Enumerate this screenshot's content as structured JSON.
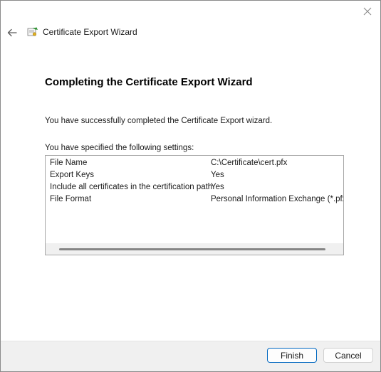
{
  "window": {
    "title": "Certificate Export Wizard",
    "icons": {
      "close": "close-icon",
      "back": "back-arrow-icon",
      "wizard": "certificate-wizard-icon"
    }
  },
  "page": {
    "heading": "Completing the Certificate Export Wizard",
    "message": "You have successfully completed the Certificate Export wizard.",
    "settings_label": "You have specified the following settings:"
  },
  "settings": [
    {
      "name": "File Name",
      "value": "C:\\Certificate\\cert.pfx"
    },
    {
      "name": "Export Keys",
      "value": "Yes"
    },
    {
      "name": "Include all certificates in the certification path",
      "value": "Yes"
    },
    {
      "name": "File Format",
      "value": "Personal Information Exchange (*.pfx)"
    }
  ],
  "buttons": {
    "finish": "Finish",
    "cancel": "Cancel"
  },
  "colors": {
    "accent": "#0067c0",
    "footer_bg": "#f0f0f0"
  }
}
